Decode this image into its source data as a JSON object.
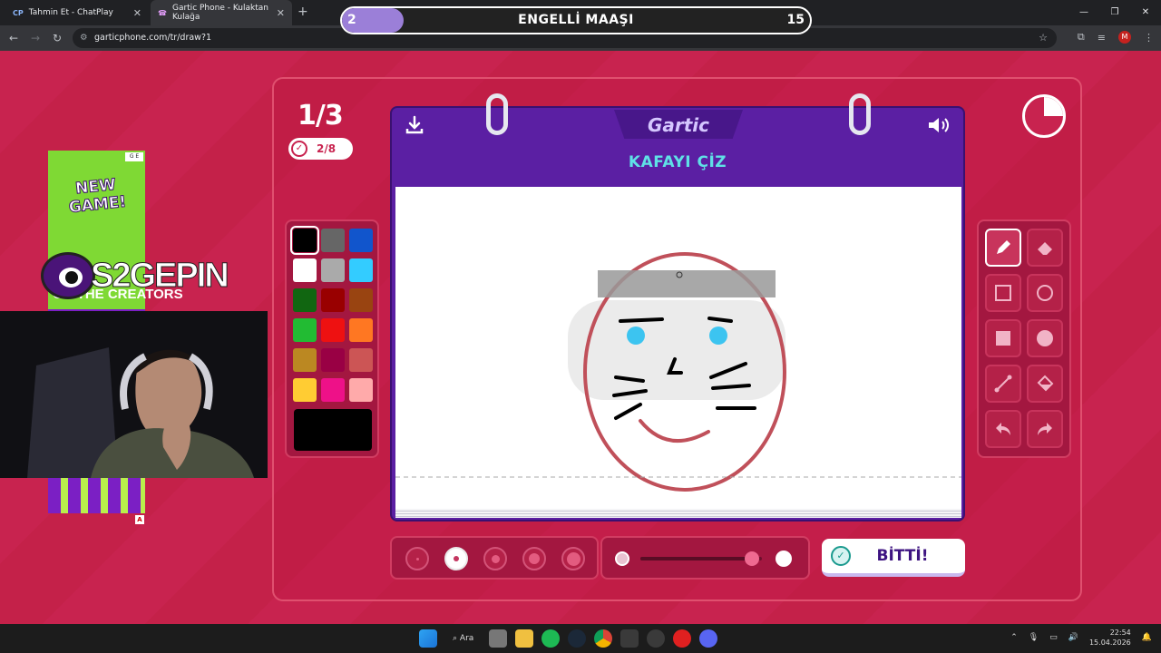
{
  "browser": {
    "tabs": [
      {
        "favicon": "CP",
        "label": "Tahmin Et - ChatPlay",
        "active": false
      },
      {
        "favicon": "☎",
        "label": "Gartic Phone - Kulaktan Kulağa",
        "active": true
      }
    ],
    "url": "garticphone.com/tr/draw?1",
    "profile_initial": "M"
  },
  "overlay": {
    "round": "2",
    "title": "ENGELLİ MAAŞI",
    "count": "15",
    "progress_fraction": 0.13
  },
  "game": {
    "turn_progress": "1/3",
    "players_done": "2/8",
    "logo": "Gartic",
    "task": "KAFAYI ÇİZ",
    "done_button": "BİTTİ!",
    "timer_elapsed_fraction": 0.25,
    "selected_color": "#000000",
    "colors": [
      "#000000",
      "#666666",
      "#1155cc",
      "#ffffff",
      "#aaaaaa",
      "#33ccff",
      "#116611",
      "#990000",
      "#994411",
      "#22bb33",
      "#ee1111",
      "#ff7722",
      "#bb8822",
      "#990044",
      "#cc5555",
      "#ffcc33",
      "#ee1188",
      "#ffaaaa"
    ],
    "tools": [
      "pencil-tool",
      "eraser-tool",
      "rectangle-outline-tool",
      "ellipse-outline-tool",
      "rectangle-fill-tool",
      "ellipse-fill-tool",
      "line-tool",
      "bucket-tool",
      "undo-tool",
      "redo-tool"
    ],
    "selected_tool": "pencil-tool",
    "brush_sizes": 5,
    "selected_brush_size_index": 1,
    "opacity_fraction": 0.98
  },
  "stream": {
    "ad_headline": "NEW GAME!",
    "ad_badge": "G E",
    "ad_marker": "A",
    "streamer_name": "S2GEPIN",
    "ad_footer": "ON THE CREATORS"
  },
  "taskbar": {
    "search_label": "Ara",
    "time": "22:54",
    "date": "15.04.2026"
  }
}
